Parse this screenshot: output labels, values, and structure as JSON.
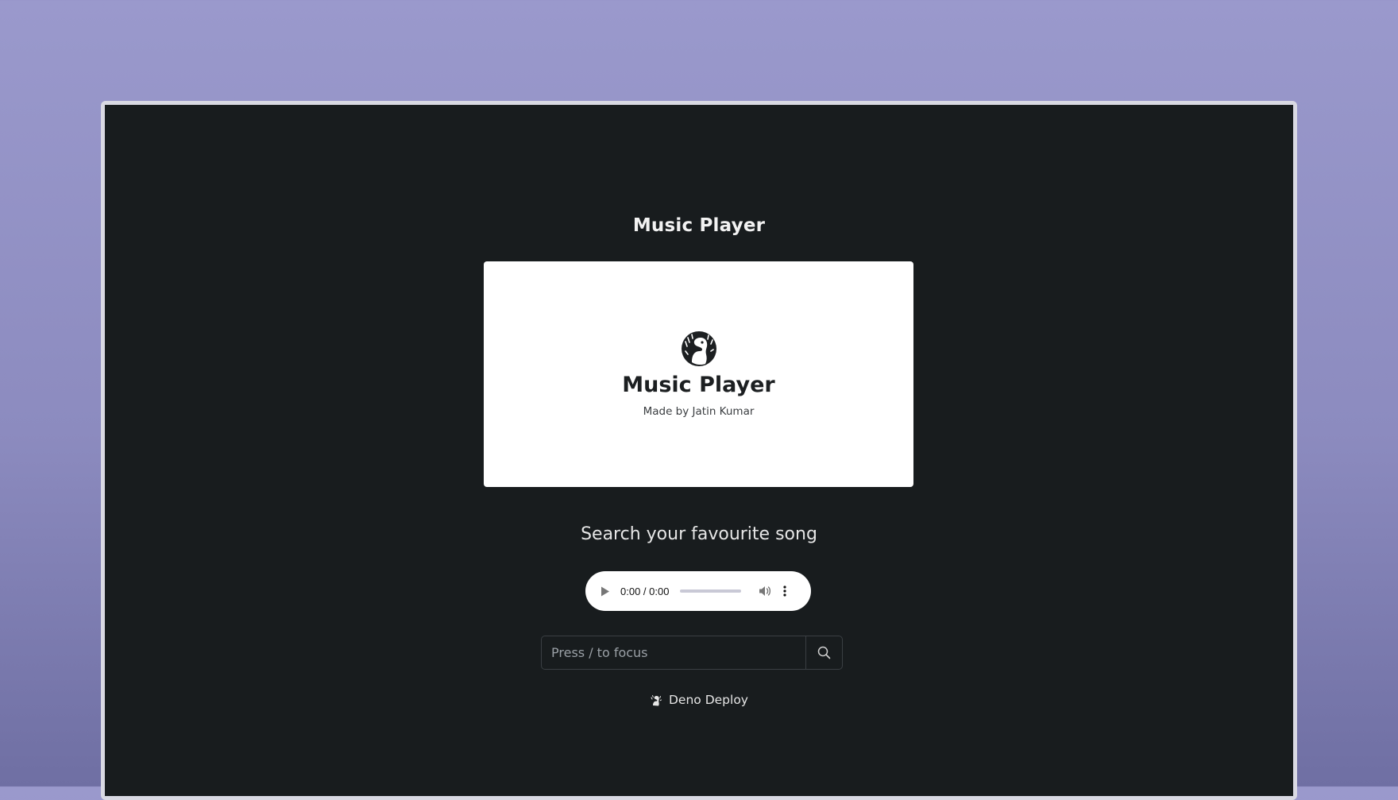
{
  "page": {
    "heading": "Music Player"
  },
  "hero": {
    "title": "Music Player",
    "subtitle": "Made by Jatin Kumar",
    "logo_icon": "deno-dinosaur-icon"
  },
  "search": {
    "heading": "Search your favourite song",
    "placeholder": "Press / to focus",
    "value": "",
    "button_icon": "search-icon"
  },
  "audio_player": {
    "time": "0:00 / 0:00",
    "progress": 0,
    "play_icon": "play-icon",
    "volume_icon": "volume-icon",
    "more_icon": "more-vertical-icon"
  },
  "footer": {
    "deploy_label": "Deno Deploy",
    "deploy_icon": "deno-icon"
  },
  "colors": {
    "background_gradient_top": "#9a99cc",
    "background_gradient_bottom": "#6f6fa3",
    "page_background": "#181c1e",
    "card_background": "#ffffff",
    "text_light": "#f2f2f2",
    "text_dark": "#1c1f21"
  }
}
